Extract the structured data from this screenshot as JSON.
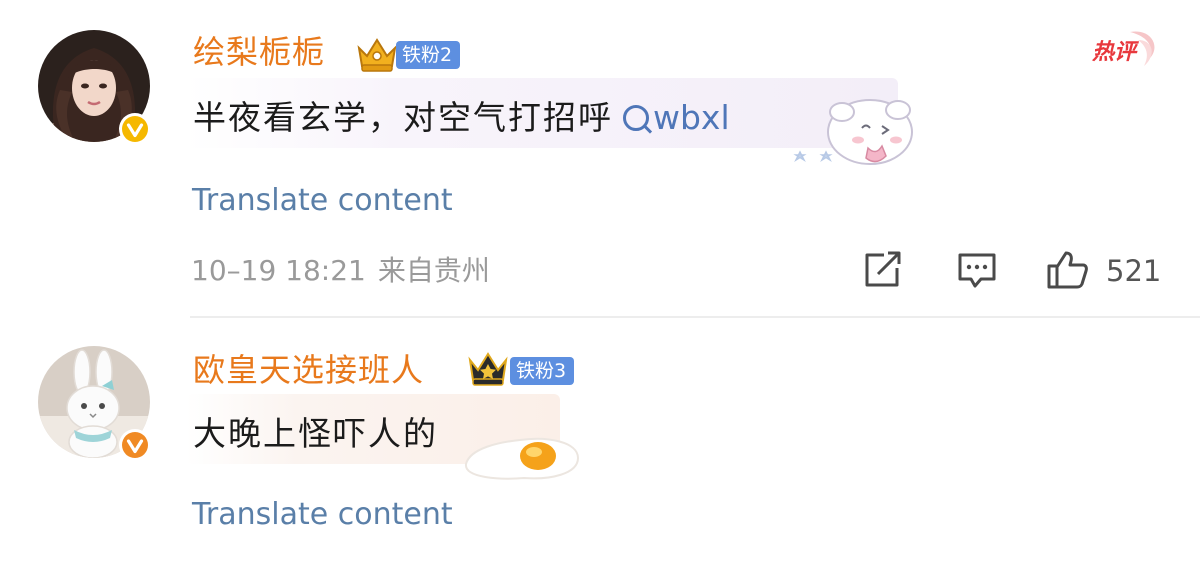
{
  "comments": [
    {
      "username": "绘梨栀栀",
      "fan_badge": "铁粉2",
      "hot_tag": "热评",
      "text": "半夜看玄学，对空气打招呼",
      "search_link": "wbxl",
      "translate": "Translate content",
      "date": "10–19 18:21",
      "location": "来自贵州",
      "likes": "521"
    },
    {
      "username": "欧皇天选接班人",
      "fan_badge": "铁粉3",
      "text": "大晚上怪吓人的",
      "translate": "Translate content"
    }
  ],
  "colors": {
    "username": "#e8791c",
    "fan_badge": "#5d8fe0",
    "link": "#4f76b8",
    "translate": "#5a7fa8",
    "meta": "#9a9a9a",
    "hot": "#e8383d",
    "verified": "#f5b800"
  },
  "icons": [
    "verified-icon",
    "crown-icon",
    "search-icon",
    "share-icon",
    "reply-icon",
    "like-icon",
    "cloud-bunny-sticker",
    "fried-egg-sticker"
  ]
}
